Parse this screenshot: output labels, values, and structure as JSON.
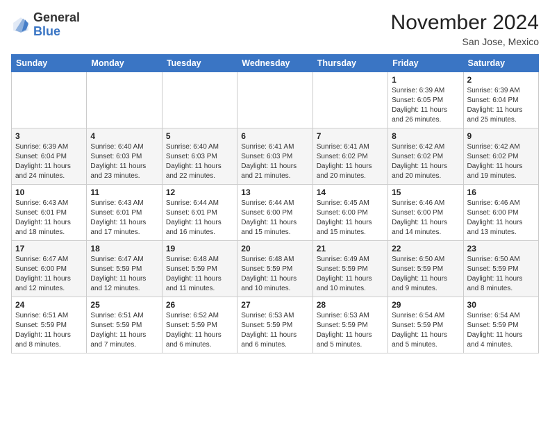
{
  "header": {
    "logo_general": "General",
    "logo_blue": "Blue",
    "month_title": "November 2024",
    "location": "San Jose, Mexico"
  },
  "days_of_week": [
    "Sunday",
    "Monday",
    "Tuesday",
    "Wednesday",
    "Thursday",
    "Friday",
    "Saturday"
  ],
  "weeks": [
    [
      {
        "day": "",
        "info": ""
      },
      {
        "day": "",
        "info": ""
      },
      {
        "day": "",
        "info": ""
      },
      {
        "day": "",
        "info": ""
      },
      {
        "day": "",
        "info": ""
      },
      {
        "day": "1",
        "info": "Sunrise: 6:39 AM\nSunset: 6:05 PM\nDaylight: 11 hours and 26 minutes."
      },
      {
        "day": "2",
        "info": "Sunrise: 6:39 AM\nSunset: 6:04 PM\nDaylight: 11 hours and 25 minutes."
      }
    ],
    [
      {
        "day": "3",
        "info": "Sunrise: 6:39 AM\nSunset: 6:04 PM\nDaylight: 11 hours and 24 minutes."
      },
      {
        "day": "4",
        "info": "Sunrise: 6:40 AM\nSunset: 6:03 PM\nDaylight: 11 hours and 23 minutes."
      },
      {
        "day": "5",
        "info": "Sunrise: 6:40 AM\nSunset: 6:03 PM\nDaylight: 11 hours and 22 minutes."
      },
      {
        "day": "6",
        "info": "Sunrise: 6:41 AM\nSunset: 6:03 PM\nDaylight: 11 hours and 21 minutes."
      },
      {
        "day": "7",
        "info": "Sunrise: 6:41 AM\nSunset: 6:02 PM\nDaylight: 11 hours and 20 minutes."
      },
      {
        "day": "8",
        "info": "Sunrise: 6:42 AM\nSunset: 6:02 PM\nDaylight: 11 hours and 20 minutes."
      },
      {
        "day": "9",
        "info": "Sunrise: 6:42 AM\nSunset: 6:02 PM\nDaylight: 11 hours and 19 minutes."
      }
    ],
    [
      {
        "day": "10",
        "info": "Sunrise: 6:43 AM\nSunset: 6:01 PM\nDaylight: 11 hours and 18 minutes."
      },
      {
        "day": "11",
        "info": "Sunrise: 6:43 AM\nSunset: 6:01 PM\nDaylight: 11 hours and 17 minutes."
      },
      {
        "day": "12",
        "info": "Sunrise: 6:44 AM\nSunset: 6:01 PM\nDaylight: 11 hours and 16 minutes."
      },
      {
        "day": "13",
        "info": "Sunrise: 6:44 AM\nSunset: 6:00 PM\nDaylight: 11 hours and 15 minutes."
      },
      {
        "day": "14",
        "info": "Sunrise: 6:45 AM\nSunset: 6:00 PM\nDaylight: 11 hours and 15 minutes."
      },
      {
        "day": "15",
        "info": "Sunrise: 6:46 AM\nSunset: 6:00 PM\nDaylight: 11 hours and 14 minutes."
      },
      {
        "day": "16",
        "info": "Sunrise: 6:46 AM\nSunset: 6:00 PM\nDaylight: 11 hours and 13 minutes."
      }
    ],
    [
      {
        "day": "17",
        "info": "Sunrise: 6:47 AM\nSunset: 6:00 PM\nDaylight: 11 hours and 12 minutes."
      },
      {
        "day": "18",
        "info": "Sunrise: 6:47 AM\nSunset: 5:59 PM\nDaylight: 11 hours and 12 minutes."
      },
      {
        "day": "19",
        "info": "Sunrise: 6:48 AM\nSunset: 5:59 PM\nDaylight: 11 hours and 11 minutes."
      },
      {
        "day": "20",
        "info": "Sunrise: 6:48 AM\nSunset: 5:59 PM\nDaylight: 11 hours and 10 minutes."
      },
      {
        "day": "21",
        "info": "Sunrise: 6:49 AM\nSunset: 5:59 PM\nDaylight: 11 hours and 10 minutes."
      },
      {
        "day": "22",
        "info": "Sunrise: 6:50 AM\nSunset: 5:59 PM\nDaylight: 11 hours and 9 minutes."
      },
      {
        "day": "23",
        "info": "Sunrise: 6:50 AM\nSunset: 5:59 PM\nDaylight: 11 hours and 8 minutes."
      }
    ],
    [
      {
        "day": "24",
        "info": "Sunrise: 6:51 AM\nSunset: 5:59 PM\nDaylight: 11 hours and 8 minutes."
      },
      {
        "day": "25",
        "info": "Sunrise: 6:51 AM\nSunset: 5:59 PM\nDaylight: 11 hours and 7 minutes."
      },
      {
        "day": "26",
        "info": "Sunrise: 6:52 AM\nSunset: 5:59 PM\nDaylight: 11 hours and 6 minutes."
      },
      {
        "day": "27",
        "info": "Sunrise: 6:53 AM\nSunset: 5:59 PM\nDaylight: 11 hours and 6 minutes."
      },
      {
        "day": "28",
        "info": "Sunrise: 6:53 AM\nSunset: 5:59 PM\nDaylight: 11 hours and 5 minutes."
      },
      {
        "day": "29",
        "info": "Sunrise: 6:54 AM\nSunset: 5:59 PM\nDaylight: 11 hours and 5 minutes."
      },
      {
        "day": "30",
        "info": "Sunrise: 6:54 AM\nSunset: 5:59 PM\nDaylight: 11 hours and 4 minutes."
      }
    ]
  ]
}
